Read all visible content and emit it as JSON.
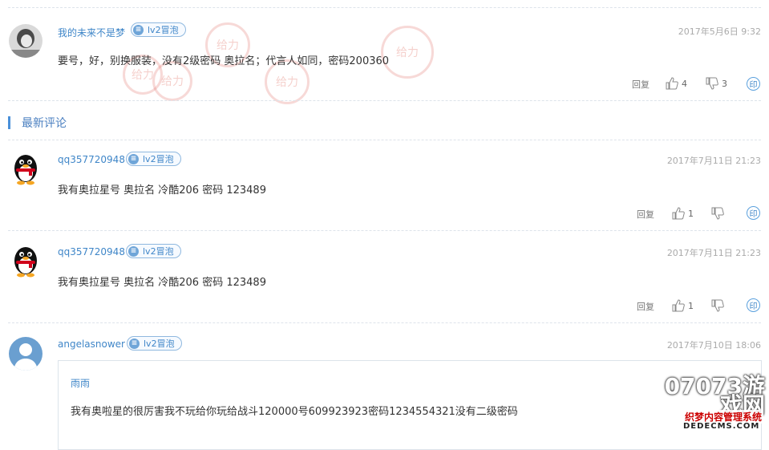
{
  "badge_label": "lv2冒泡",
  "section_title": "最新评论",
  "reply_label": "回复",
  "print_icon_label": "印",
  "comments": [
    {
      "username": "我的未来不是梦",
      "date": "2017年5月6日 9:32",
      "text": "要号，好，别换服装，没有2级密码 奥拉名；代言人如同，密码200360",
      "likes": "4",
      "dislikes": "3",
      "avatar": "photo-avatar"
    },
    {
      "username": "qq357720948",
      "date": "2017年7月11日 21:23",
      "text": "我有奥拉星号 奥拉名 冷酷206 密码 123489",
      "likes": "1",
      "dislikes": "",
      "avatar": "qq-penguin-avatar"
    },
    {
      "username": "qq357720948",
      "date": "2017年7月11日 21:23",
      "text": "我有奥拉星号 奥拉名 冷酷206 密码 123489",
      "likes": "1",
      "dislikes": "",
      "avatar": "qq-penguin-avatar"
    },
    {
      "username": "angelasnower",
      "date": "2017年7月10日 18:06",
      "avatar": "default-avatar"
    }
  ],
  "quote": {
    "author": "雨雨",
    "text": "我有奥啦星的很厉害我不玩给你玩给战斗120000号609923923密码1234554321没有二级密码"
  },
  "stamp_text": "给力",
  "watermark": {
    "logo": "07073游戏网",
    "site": "织梦内容管理系统",
    "domain": "DEDECMS.COM"
  },
  "colors": {
    "link": "#3f86c8",
    "accent": "#4a90d9",
    "stamp": "#e2786e"
  }
}
